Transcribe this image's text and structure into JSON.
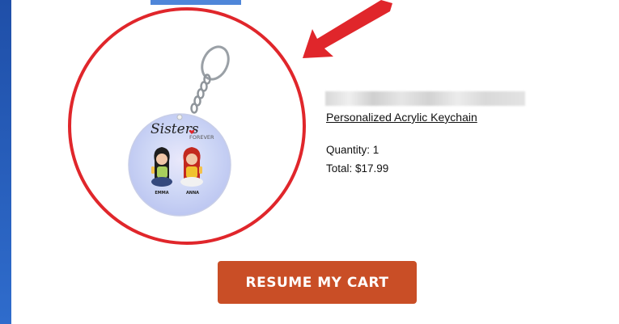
{
  "product": {
    "name": "Personalized Acrylic Keychain",
    "quantity_label": "Quantity: 1",
    "total_label": "Total: $17.99",
    "image": {
      "title": "Sisters",
      "subtitle": "FOREVER",
      "person_left": "EMMA",
      "person_right": "ANNA"
    }
  },
  "cta": {
    "label": "RESUME MY CART"
  },
  "colors": {
    "annotation_red": "#e0262b",
    "button": "#c94e26",
    "page_background": "#2f6ccc"
  },
  "icons": {
    "annotation": "arrow-icon"
  }
}
